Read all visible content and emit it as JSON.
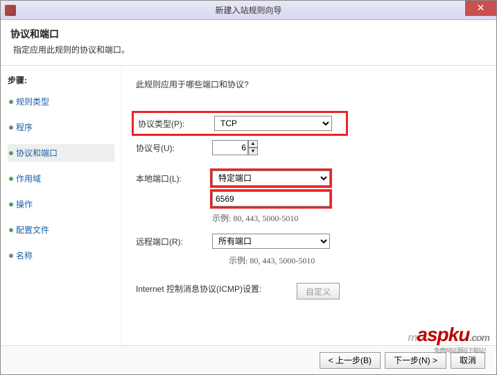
{
  "window": {
    "title": "新建入站规则向导"
  },
  "header": {
    "title": "协议和端口",
    "desc": "指定应用此规则的协议和端口。"
  },
  "sidebar": {
    "steps_label": "步骤:",
    "items": [
      {
        "label": "规则类型"
      },
      {
        "label": "程序"
      },
      {
        "label": "协议和端口"
      },
      {
        "label": "作用域"
      },
      {
        "label": "操作"
      },
      {
        "label": "配置文件"
      },
      {
        "label": "名称"
      }
    ],
    "active_index": 2
  },
  "main": {
    "question": "此规则应用于哪些端口和协议?",
    "protocol_type_label": "协议类型(P):",
    "protocol_type_value": "TCP",
    "protocol_number_label": "协议号(U):",
    "protocol_number_value": "6",
    "local_port_label": "本地端口(L):",
    "local_port_mode": "特定端口",
    "local_port_value": "6569",
    "local_port_hint": "示例: 80, 443, 5000-5010",
    "remote_port_label": "远程端口(R):",
    "remote_port_mode": "所有端口",
    "remote_port_hint": "示例: 80, 443, 5000-5010",
    "icmp_label": "Internet 控制消息协议(ICMP)设置:",
    "icmp_button": "自定义"
  },
  "footer": {
    "back": "< 上一步(B)",
    "next": "下一步(N) >",
    "cancel": "取消"
  },
  "watermark": {
    "m": "m",
    "text": "aspku",
    "com": ".com",
    "sub": "免费网站源码下载站！"
  }
}
